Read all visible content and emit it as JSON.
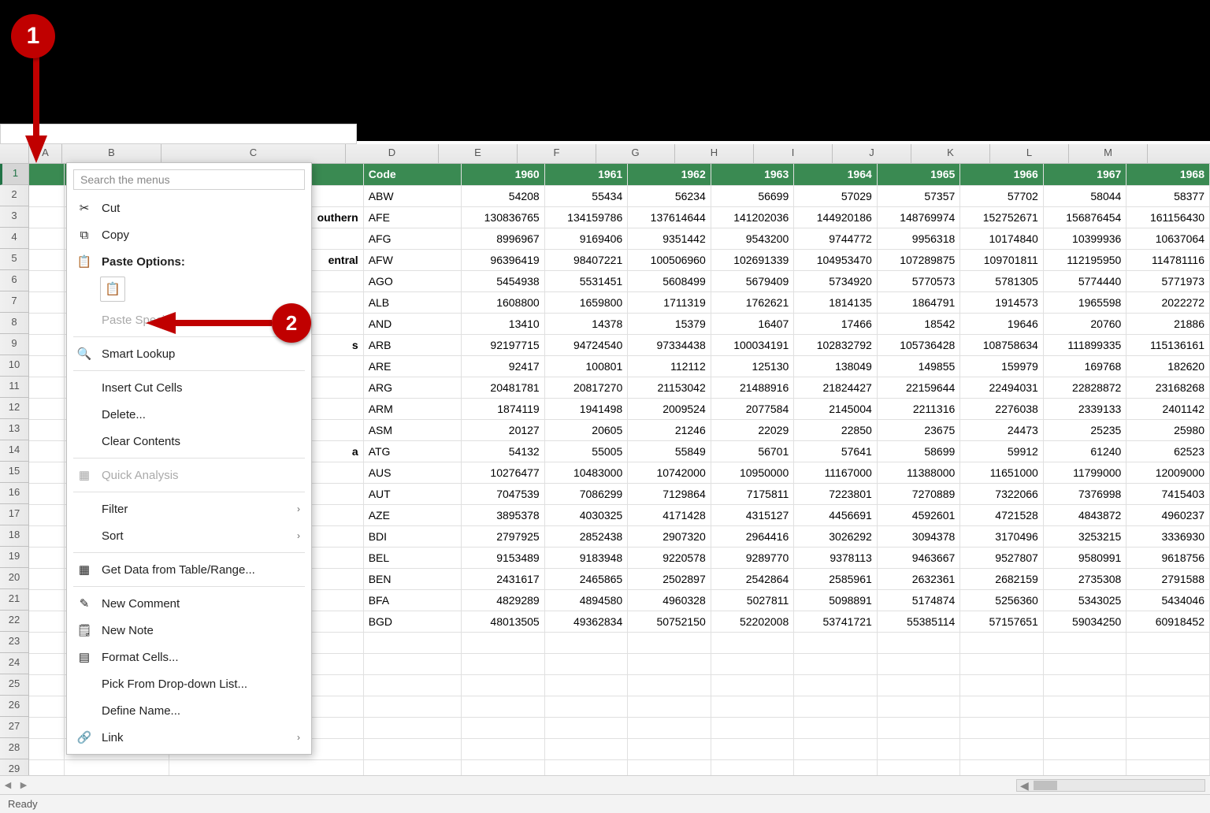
{
  "annotation": {
    "label1": "1",
    "label2": "2"
  },
  "columns": {
    "A": "A",
    "B": "B",
    "C": "C",
    "D": "D",
    "E": "E",
    "F": "F",
    "G": "G",
    "H": "H",
    "I": "I",
    "J": "J",
    "K": "K",
    "L": "L",
    "M": "M"
  },
  "header": {
    "code": "Code",
    "y1960": "1960",
    "y1961": "1961",
    "y1962": "1962",
    "y1963": "1963",
    "y1964": "1964",
    "y1965": "1965",
    "y1966": "1966",
    "y1967": "1967",
    "y1968": "1968"
  },
  "visible_text": {
    "row3": "outhern",
    "row5": "entral",
    "row9": "s",
    "row14": "a"
  },
  "rows": [
    {
      "code": "ABW",
      "v": [
        "54208",
        "55434",
        "56234",
        "56699",
        "57029",
        "57357",
        "57702",
        "58044",
        "58377"
      ]
    },
    {
      "code": "AFE",
      "v": [
        "130836765",
        "134159786",
        "137614644",
        "141202036",
        "144920186",
        "148769974",
        "152752671",
        "156876454",
        "161156430"
      ]
    },
    {
      "code": "AFG",
      "v": [
        "8996967",
        "9169406",
        "9351442",
        "9543200",
        "9744772",
        "9956318",
        "10174840",
        "10399936",
        "10637064"
      ]
    },
    {
      "code": "AFW",
      "v": [
        "96396419",
        "98407221",
        "100506960",
        "102691339",
        "104953470",
        "107289875",
        "109701811",
        "112195950",
        "114781116"
      ]
    },
    {
      "code": "AGO",
      "v": [
        "5454938",
        "5531451",
        "5608499",
        "5679409",
        "5734920",
        "5770573",
        "5781305",
        "5774440",
        "5771973"
      ]
    },
    {
      "code": "ALB",
      "v": [
        "1608800",
        "1659800",
        "1711319",
        "1762621",
        "1814135",
        "1864791",
        "1914573",
        "1965598",
        "2022272"
      ]
    },
    {
      "code": "AND",
      "v": [
        "13410",
        "14378",
        "15379",
        "16407",
        "17466",
        "18542",
        "19646",
        "20760",
        "21886"
      ]
    },
    {
      "code": "ARB",
      "v": [
        "92197715",
        "94724540",
        "97334438",
        "100034191",
        "102832792",
        "105736428",
        "108758634",
        "111899335",
        "115136161"
      ]
    },
    {
      "code": "ARE",
      "v": [
        "92417",
        "100801",
        "112112",
        "125130",
        "138049",
        "149855",
        "159979",
        "169768",
        "182620"
      ]
    },
    {
      "code": "ARG",
      "v": [
        "20481781",
        "20817270",
        "21153042",
        "21488916",
        "21824427",
        "22159644",
        "22494031",
        "22828872",
        "23168268"
      ]
    },
    {
      "code": "ARM",
      "v": [
        "1874119",
        "1941498",
        "2009524",
        "2077584",
        "2145004",
        "2211316",
        "2276038",
        "2339133",
        "2401142"
      ]
    },
    {
      "code": "ASM",
      "v": [
        "20127",
        "20605",
        "21246",
        "22029",
        "22850",
        "23675",
        "24473",
        "25235",
        "25980"
      ]
    },
    {
      "code": "ATG",
      "v": [
        "54132",
        "55005",
        "55849",
        "56701",
        "57641",
        "58699",
        "59912",
        "61240",
        "62523"
      ]
    },
    {
      "code": "AUS",
      "v": [
        "10276477",
        "10483000",
        "10742000",
        "10950000",
        "11167000",
        "11388000",
        "11651000",
        "11799000",
        "12009000"
      ]
    },
    {
      "code": "AUT",
      "v": [
        "7047539",
        "7086299",
        "7129864",
        "7175811",
        "7223801",
        "7270889",
        "7322066",
        "7376998",
        "7415403"
      ]
    },
    {
      "code": "AZE",
      "v": [
        "3895378",
        "4030325",
        "4171428",
        "4315127",
        "4456691",
        "4592601",
        "4721528",
        "4843872",
        "4960237"
      ]
    },
    {
      "code": "BDI",
      "v": [
        "2797925",
        "2852438",
        "2907320",
        "2964416",
        "3026292",
        "3094378",
        "3170496",
        "3253215",
        "3336930"
      ]
    },
    {
      "code": "BEL",
      "v": [
        "9153489",
        "9183948",
        "9220578",
        "9289770",
        "9378113",
        "9463667",
        "9527807",
        "9580991",
        "9618756"
      ]
    },
    {
      "code": "BEN",
      "v": [
        "2431617",
        "2465865",
        "2502897",
        "2542864",
        "2585961",
        "2632361",
        "2682159",
        "2735308",
        "2791588"
      ]
    },
    {
      "code": "BFA",
      "v": [
        "4829289",
        "4894580",
        "4960328",
        "5027811",
        "5098891",
        "5174874",
        "5256360",
        "5343025",
        "5434046"
      ]
    },
    {
      "code": "BGD",
      "v": [
        "48013505",
        "49362834",
        "50752150",
        "52202008",
        "53741721",
        "55385114",
        "57157651",
        "59034250",
        "60918452"
      ]
    }
  ],
  "ctx": {
    "search_placeholder": "Search the menus",
    "cut": "Cut",
    "copy": "Copy",
    "paste_options": "Paste Options:",
    "paste_special": "Paste Special...",
    "smart_lookup": "Smart Lookup",
    "insert_cut": "Insert Cut Cells",
    "delete": "Delete...",
    "clear": "Clear Contents",
    "quick_analysis": "Quick Analysis",
    "filter": "Filter",
    "sort": "Sort",
    "get_data": "Get Data from Table/Range...",
    "new_comment": "New Comment",
    "new_note": "New Note",
    "format_cells": "Format Cells...",
    "pick_list": "Pick From Drop-down List...",
    "define_name": "Define Name...",
    "link": "Link"
  },
  "status": {
    "ready": "Ready"
  }
}
